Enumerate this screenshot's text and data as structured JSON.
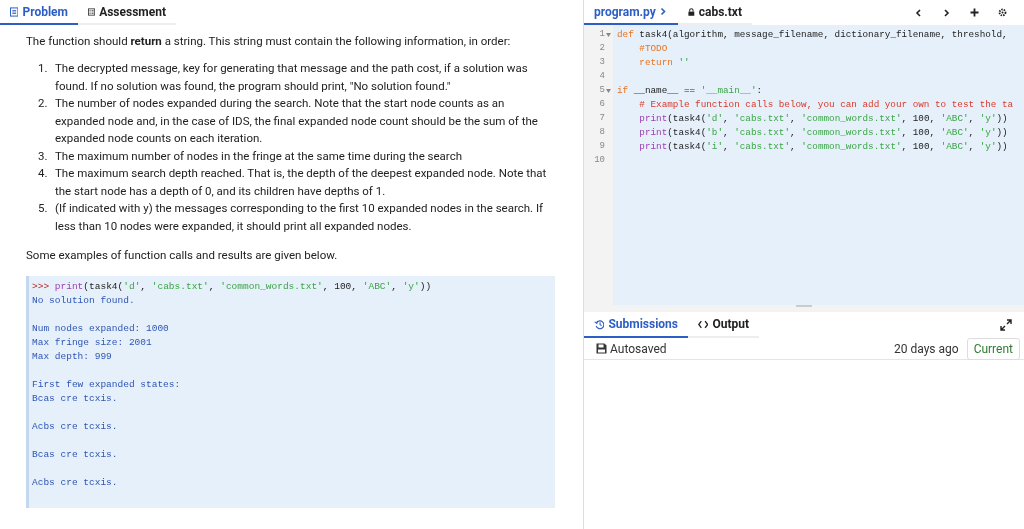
{
  "left_tabs": [
    {
      "label": "Problem",
      "selected": true
    },
    {
      "label": "Assessment",
      "selected": false
    }
  ],
  "problem": {
    "intro": "The function should **return** a string. This string must contain the following information, in order:",
    "items": [
      {
        "number": "1.",
        "text": "The decrypted message, key for generating that message and the path cost, if a solution was found. If no solution was found, the program should print, \"No solution found.\""
      },
      {
        "number": "2.",
        "text": "The number of nodes expanded during the search. Note that the start node counts as an expanded node and, in the case of IDS, the final expanded node count should be the sum of the expanded node counts on each iteration."
      },
      {
        "number": "3.",
        "text": "The maximum number of nodes in the fringe at the same time during the search"
      },
      {
        "number": "4.",
        "text": "The maximum search depth reached. That is, the depth of the deepest expanded node. Note that the start node has a depth of 0, and its children have depths of 1."
      },
      {
        "number": "5.",
        "text": "(If indicated with y) the messages corresponding to the first 10 expanded nodes in the search. If less than 10 nodes were expanded, it should print all expanded nodes."
      }
    ],
    "examples_intro": "Some examples of function calls and results are given below.",
    "example": {
      "prompt": [
        {
          "kind": "prompt",
          "text": ">>> "
        },
        {
          "kind": "builtin",
          "text": "print"
        },
        {
          "kind": "plain",
          "text": "(task4("
        },
        {
          "kind": "string",
          "text": "'d'"
        },
        {
          "kind": "plain",
          "text": ", "
        },
        {
          "kind": "string",
          "text": "'cabs.txt'"
        },
        {
          "kind": "plain",
          "text": ", "
        },
        {
          "kind": "string",
          "text": "'common_words.txt'"
        },
        {
          "kind": "plain",
          "text": ", 100, "
        },
        {
          "kind": "string",
          "text": "'ABC'"
        },
        {
          "kind": "plain",
          "text": ", "
        },
        {
          "kind": "string",
          "text": "'y'"
        },
        {
          "kind": "plain",
          "text": "))"
        }
      ],
      "output_groups": [
        [
          "No solution found."
        ],
        [
          "Num nodes expanded: 1000",
          "Max fringe size: 2001",
          "Max depth: 999"
        ],
        [
          "First few expanded states:",
          "Bcas cre tcxis."
        ],
        [
          "Acbs cre tcxis."
        ],
        [
          "Bcas cre tcxis."
        ],
        [
          "Acbs cre tcxis."
        ]
      ]
    }
  },
  "editor_tabs": [
    {
      "label": "program.py",
      "selected": true
    },
    {
      "label": "cabs.txt",
      "selected": false
    }
  ],
  "editor_lines": [
    {
      "number": "1",
      "foldable": true,
      "tokens": [
        {
          "kind": "keyword",
          "text": "def"
        },
        {
          "kind": "plain",
          "text": " task4(algorithm, message_filename, dictionary_filename, threshold,"
        }
      ]
    },
    {
      "number": "2",
      "foldable": false,
      "tokens": [
        {
          "kind": "keyword",
          "text": "    #TODO"
        }
      ]
    },
    {
      "number": "3",
      "foldable": false,
      "tokens": [
        {
          "kind": "keyword",
          "text": "    return"
        },
        {
          "kind": "string",
          "text": " ''"
        }
      ]
    },
    {
      "number": "4",
      "foldable": false
    },
    {
      "number": "5",
      "foldable": true,
      "tokens": [
        {
          "kind": "keyword",
          "text": "if"
        },
        {
          "kind": "plain",
          "text": " __name__ == "
        },
        {
          "kind": "string",
          "text": "'__main__'"
        },
        {
          "kind": "plain",
          "text": ":"
        }
      ]
    },
    {
      "number": "6",
      "foldable": false,
      "tokens": [
        {
          "kind": "comment",
          "text": "    # Example function calls below, you can add your own to test the ta"
        }
      ]
    },
    {
      "number": "7",
      "foldable": false,
      "tokens": [
        {
          "kind": "builtin",
          "text": "    print"
        },
        {
          "kind": "plain",
          "text": "(task4("
        },
        {
          "kind": "string",
          "text": "'d'"
        },
        {
          "kind": "plain",
          "text": ", "
        },
        {
          "kind": "string",
          "text": "'cabs.txt'"
        },
        {
          "kind": "plain",
          "text": ", "
        },
        {
          "kind": "string",
          "text": "'common_words.txt'"
        },
        {
          "kind": "plain",
          "text": ", 100, "
        },
        {
          "kind": "string",
          "text": "'ABC'"
        },
        {
          "kind": "plain",
          "text": ", "
        },
        {
          "kind": "string",
          "text": "'y'"
        },
        {
          "kind": "plain",
          "text": "))"
        }
      ]
    },
    {
      "number": "8",
      "foldable": false,
      "tokens": [
        {
          "kind": "builtin",
          "text": "    print"
        },
        {
          "kind": "plain",
          "text": "(task4("
        },
        {
          "kind": "string",
          "text": "'b'"
        },
        {
          "kind": "plain",
          "text": ", "
        },
        {
          "kind": "string",
          "text": "'cabs.txt'"
        },
        {
          "kind": "plain",
          "text": ", "
        },
        {
          "kind": "string",
          "text": "'common_words.txt'"
        },
        {
          "kind": "plain",
          "text": ", 100, "
        },
        {
          "kind": "string",
          "text": "'ABC'"
        },
        {
          "kind": "plain",
          "text": ", "
        },
        {
          "kind": "string",
          "text": "'y'"
        },
        {
          "kind": "plain",
          "text": "))"
        }
      ]
    },
    {
      "number": "9",
      "foldable": false,
      "tokens": [
        {
          "kind": "builtin",
          "text": "    print"
        },
        {
          "kind": "plain",
          "text": "(task4("
        },
        {
          "kind": "string",
          "text": "'i'"
        },
        {
          "kind": "plain",
          "text": ", "
        },
        {
          "kind": "string",
          "text": "'cabs.txt'"
        },
        {
          "kind": "plain",
          "text": ", "
        },
        {
          "kind": "string",
          "text": "'common_words.txt'"
        },
        {
          "kind": "plain",
          "text": ", 100, "
        },
        {
          "kind": "string",
          "text": "'ABC'"
        },
        {
          "kind": "plain",
          "text": ", "
        },
        {
          "kind": "string",
          "text": "'y'"
        },
        {
          "kind": "plain",
          "text": "))"
        }
      ]
    },
    {
      "number": "10",
      "foldable": false
    }
  ],
  "bottom_tabs": [
    {
      "label": "Submissions",
      "selected": true
    },
    {
      "label": "Output",
      "selected": false
    }
  ],
  "submission": {
    "label": "Autosaved",
    "time": "20 days ago",
    "badge": "Current"
  }
}
